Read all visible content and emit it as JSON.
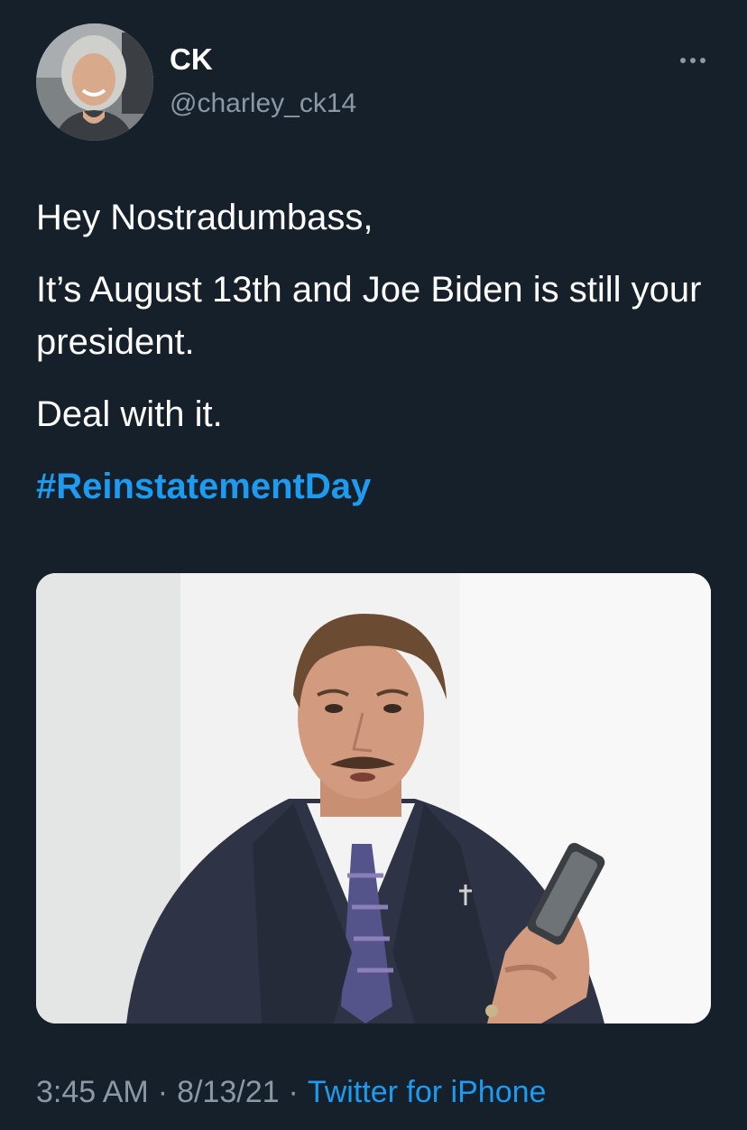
{
  "author": {
    "display_name": "CK",
    "handle": "@charley_ck14",
    "avatar_icon": "user-avatar-photo"
  },
  "menu": {
    "more_icon": "more-options-icon"
  },
  "tweet": {
    "paragraphs": [
      "Hey Nostradumbass,",
      "It’s August 13th and Joe Biden is still your president.",
      "Deal with it."
    ],
    "hashtag": "#ReinstatementDay"
  },
  "media": {
    "type": "photo"
  },
  "meta": {
    "time": "3:45 AM",
    "separator": "·",
    "date": "8/13/21",
    "source": "Twitter for iPhone"
  },
  "colors": {
    "background": "#15202b",
    "text": "#ffffff",
    "secondary_text": "#8b98a5",
    "accent": "#1d9bf0"
  }
}
